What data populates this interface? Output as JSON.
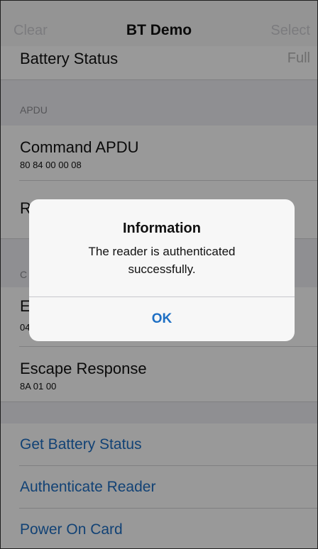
{
  "navbar": {
    "left_label": "Clear",
    "title": "BT Demo",
    "right_label": "Select"
  },
  "battery": {
    "label": "Battery Status",
    "value": "Full"
  },
  "apdu_section": {
    "header": "APDU",
    "command": {
      "label": "Command APDU",
      "value": "80 84 00 00 08"
    },
    "response_initial": "R"
  },
  "escape_section": {
    "header_initial": "C",
    "command_initial": "E",
    "command_value_partial": "04",
    "response": {
      "label": "Escape Response",
      "value": "8A 01 00"
    }
  },
  "actions": [
    {
      "label": "Get Battery Status"
    },
    {
      "label": "Authenticate Reader"
    },
    {
      "label": "Power On Card"
    }
  ],
  "alert": {
    "title": "Information",
    "message": "The reader is authenticated successfully.",
    "button_label": "OK"
  },
  "colors": {
    "accent": "#1e6fc4",
    "background": "#efeff4",
    "separator": "#d4d4d8"
  }
}
